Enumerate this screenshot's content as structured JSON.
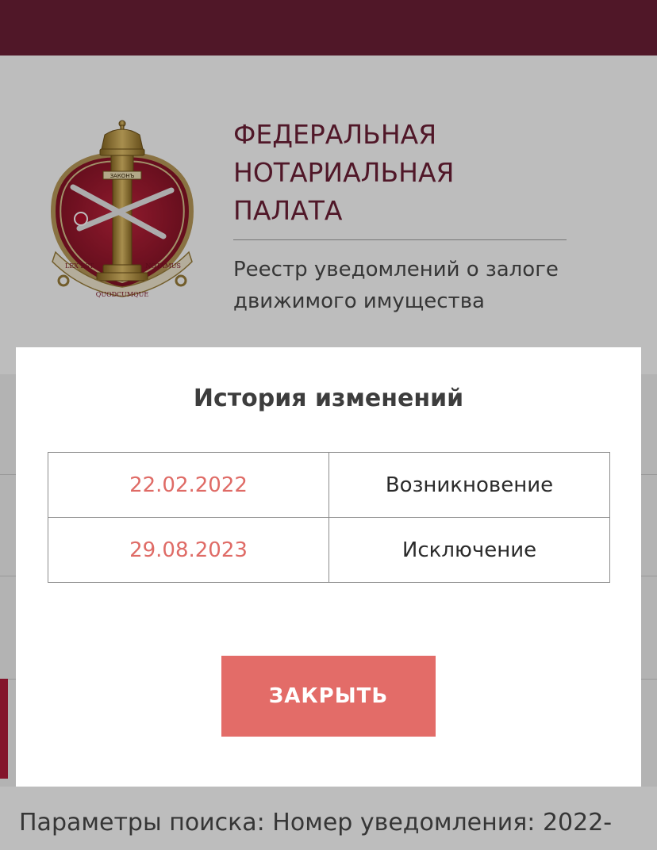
{
  "header": {
    "org_name_lines": [
      "Федеральная",
      "нотариальная",
      "палата"
    ],
    "subtitle": "Реестр уведомлений о залоге движимого имущества",
    "emblem": {
      "top_text": "ЗАКОНЪ",
      "ribbon_left": "LEX EST",
      "ribbon_bottom": "QUODCUMQUE",
      "ribbon_right": "NOTAMUS"
    }
  },
  "modal": {
    "title": "История изменений",
    "rows": [
      {
        "date": "22.02.2022",
        "event": "Возникновение"
      },
      {
        "date": "29.08.2023",
        "event": "Исключение"
      }
    ],
    "close_label": "ЗАКРЫТЬ"
  },
  "page": {
    "search_params": "Параметры поиска: Номер уведомления: 2022-"
  },
  "colors": {
    "brand_burgundy": "#6d1f36",
    "accent_red": "#e36c68",
    "date_text": "#df6b66"
  }
}
